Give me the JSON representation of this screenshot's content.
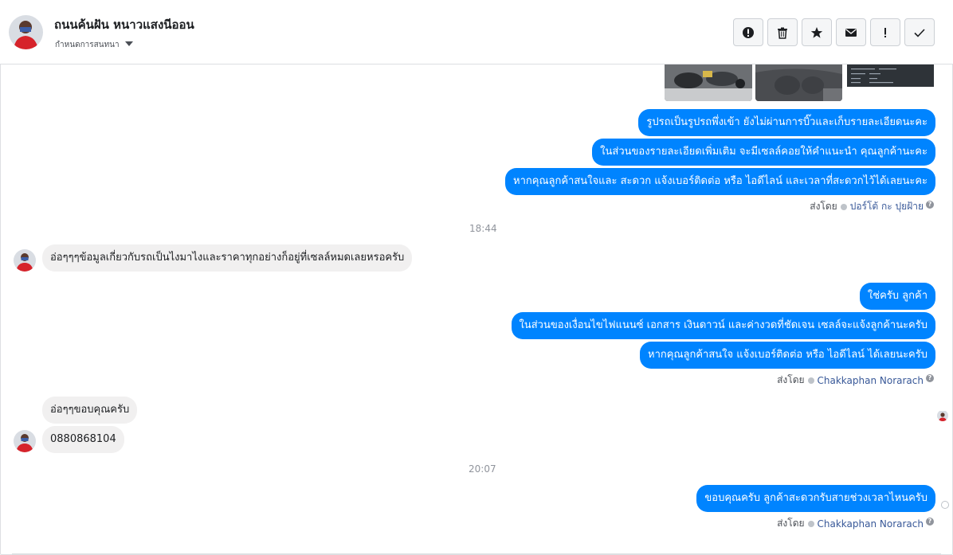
{
  "header": {
    "contact_name": "ถนนค้นฝัน หนาวแสงนีออน",
    "assign_label": "กำหนดการสนทนา",
    "actions": [
      {
        "name": "mark-spam-button",
        "icon": "alert-circle-icon"
      },
      {
        "name": "delete-button",
        "icon": "trash-icon"
      },
      {
        "name": "star-button",
        "icon": "star-icon"
      },
      {
        "name": "mark-unread-button",
        "icon": "envelope-icon"
      },
      {
        "name": "follow-up-button",
        "icon": "exclamation-icon"
      },
      {
        "name": "mark-done-button",
        "icon": "checkmark-icon"
      }
    ]
  },
  "thread": {
    "block1": {
      "messages": [
        "รูปรถเป็นรูปรถพึ่งเข้า ยังไม่ผ่านการบิ๊วและเก็บรายละเอียดนะคะ",
        "ในส่วนของรายละเอียดเพิ่มเติม จะมีเซลล์คอยให้คำแนะนำ คุณลูกค้านะคะ",
        "หากคุณลูกค้าสนใจและ สะดวก แจ้งเบอร์ติดต่อ หรือ ไอดีไลน์ และเวลาที่สะดวกไว้ได้เลยนะคะ"
      ],
      "sent_by_label": "ส่งโดย",
      "sender": "ปอร์โต้ กะ ปุยฝ้าย"
    },
    "time1": "18:44",
    "incoming1": "อ่อๆๆๆข้อมูลเกี่ยวกับรถเป็นไงมาไงและราคาทุกอย่างก็อยู่ที่เซลล์หมดเลยหรอครับ",
    "block2": {
      "messages": [
        "ใช่ครับ ลูกค้า",
        "ในส่วนของเงื่อนไขไฟแนนซ์ เอกสาร เงินดาวน์ และค่างวดที่ชัดเจน เซลล์จะแจ้งลูกค้านะครับ",
        "หากคุณลูกค้าสนใจ แจ้งเบอร์ติดต่อ หรือ ไอดีไลน์ ได้เลยนะครับ"
      ],
      "sent_by_label": "ส่งโดย",
      "sender": "Chakkaphan Norarach"
    },
    "incoming2": [
      "อ่อๆๆขอบคุณครับ",
      "0880868104"
    ],
    "time2": "20:07",
    "block3": {
      "messages": [
        "ขอบคุณครับ ลูกค้าสะดวกรับสายช่วงเวลาไหนครับ"
      ],
      "sent_by_label": "ส่งโดย",
      "sender": "Chakkaphan Norarach"
    },
    "help_glyph": "?"
  },
  "colors": {
    "outgoing_bubble": "#0084ff",
    "incoming_bubble": "#f1f0f0",
    "sender_link": "#385898"
  }
}
